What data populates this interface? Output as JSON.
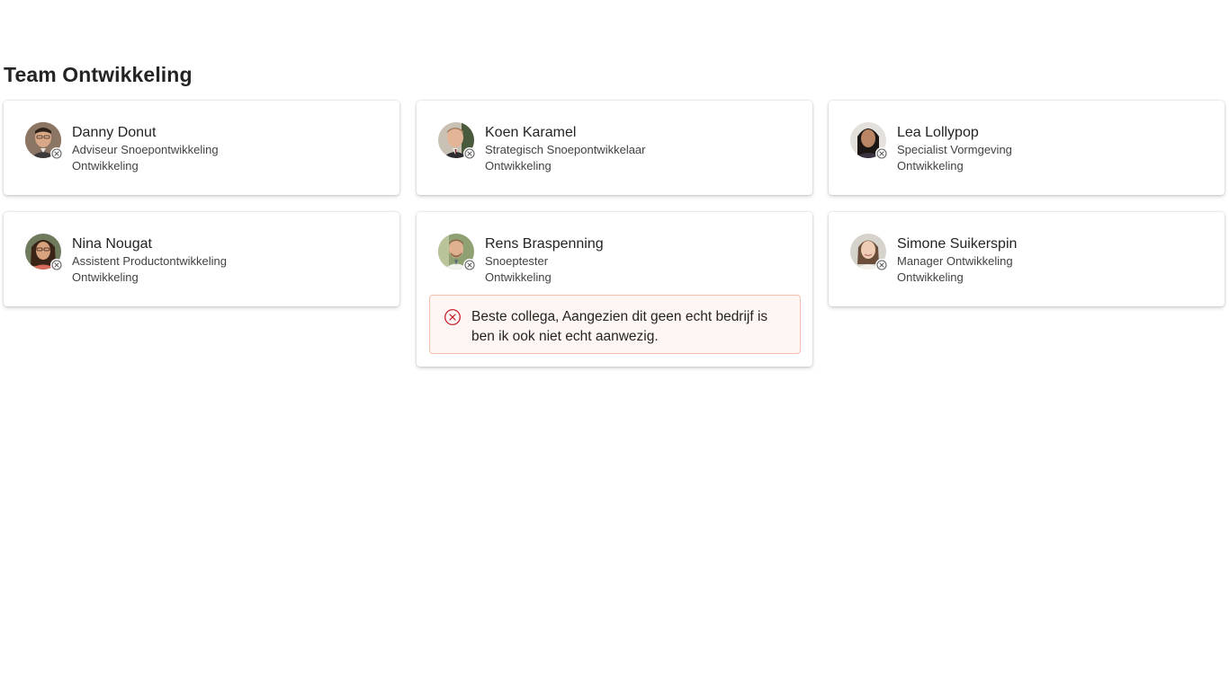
{
  "team": {
    "title": "Team Ontwikkeling"
  },
  "colors": {
    "accent_message_border": "#f4bfab",
    "message_background": "#fdf6f3",
    "presence_icon": "#616161",
    "message_icon": "#c50f1f"
  },
  "members": [
    {
      "name": "Danny Donut",
      "role": "Adviseur Snoepontwikkeling",
      "department": "Ontwikkeling",
      "presence_icon": "presence-offline-icon"
    },
    {
      "name": "Koen Karamel",
      "role": "Strategisch Snoepontwikkelaar",
      "department": "Ontwikkeling",
      "presence_icon": "presence-offline-icon"
    },
    {
      "name": "Lea Lollypop",
      "role": "Specialist Vormgeving",
      "department": "Ontwikkeling",
      "presence_icon": "presence-offline-icon"
    },
    {
      "name": "Nina Nougat",
      "role": "Assistent Productontwikkeling",
      "department": "Ontwikkeling",
      "presence_icon": "presence-offline-icon"
    },
    {
      "name": "Rens Braspenning",
      "role": "Snoeptester",
      "department": "Ontwikkeling",
      "presence_icon": "presence-offline-icon",
      "status_message": "Beste collega, Aangezien dit geen echt bedrijf is ben ik ook niet echt aanwezig."
    },
    {
      "name": "Simone Suikerspin",
      "role": "Manager Ontwikkeling",
      "department": "Ontwikkeling",
      "presence_icon": "presence-offline-icon"
    }
  ]
}
